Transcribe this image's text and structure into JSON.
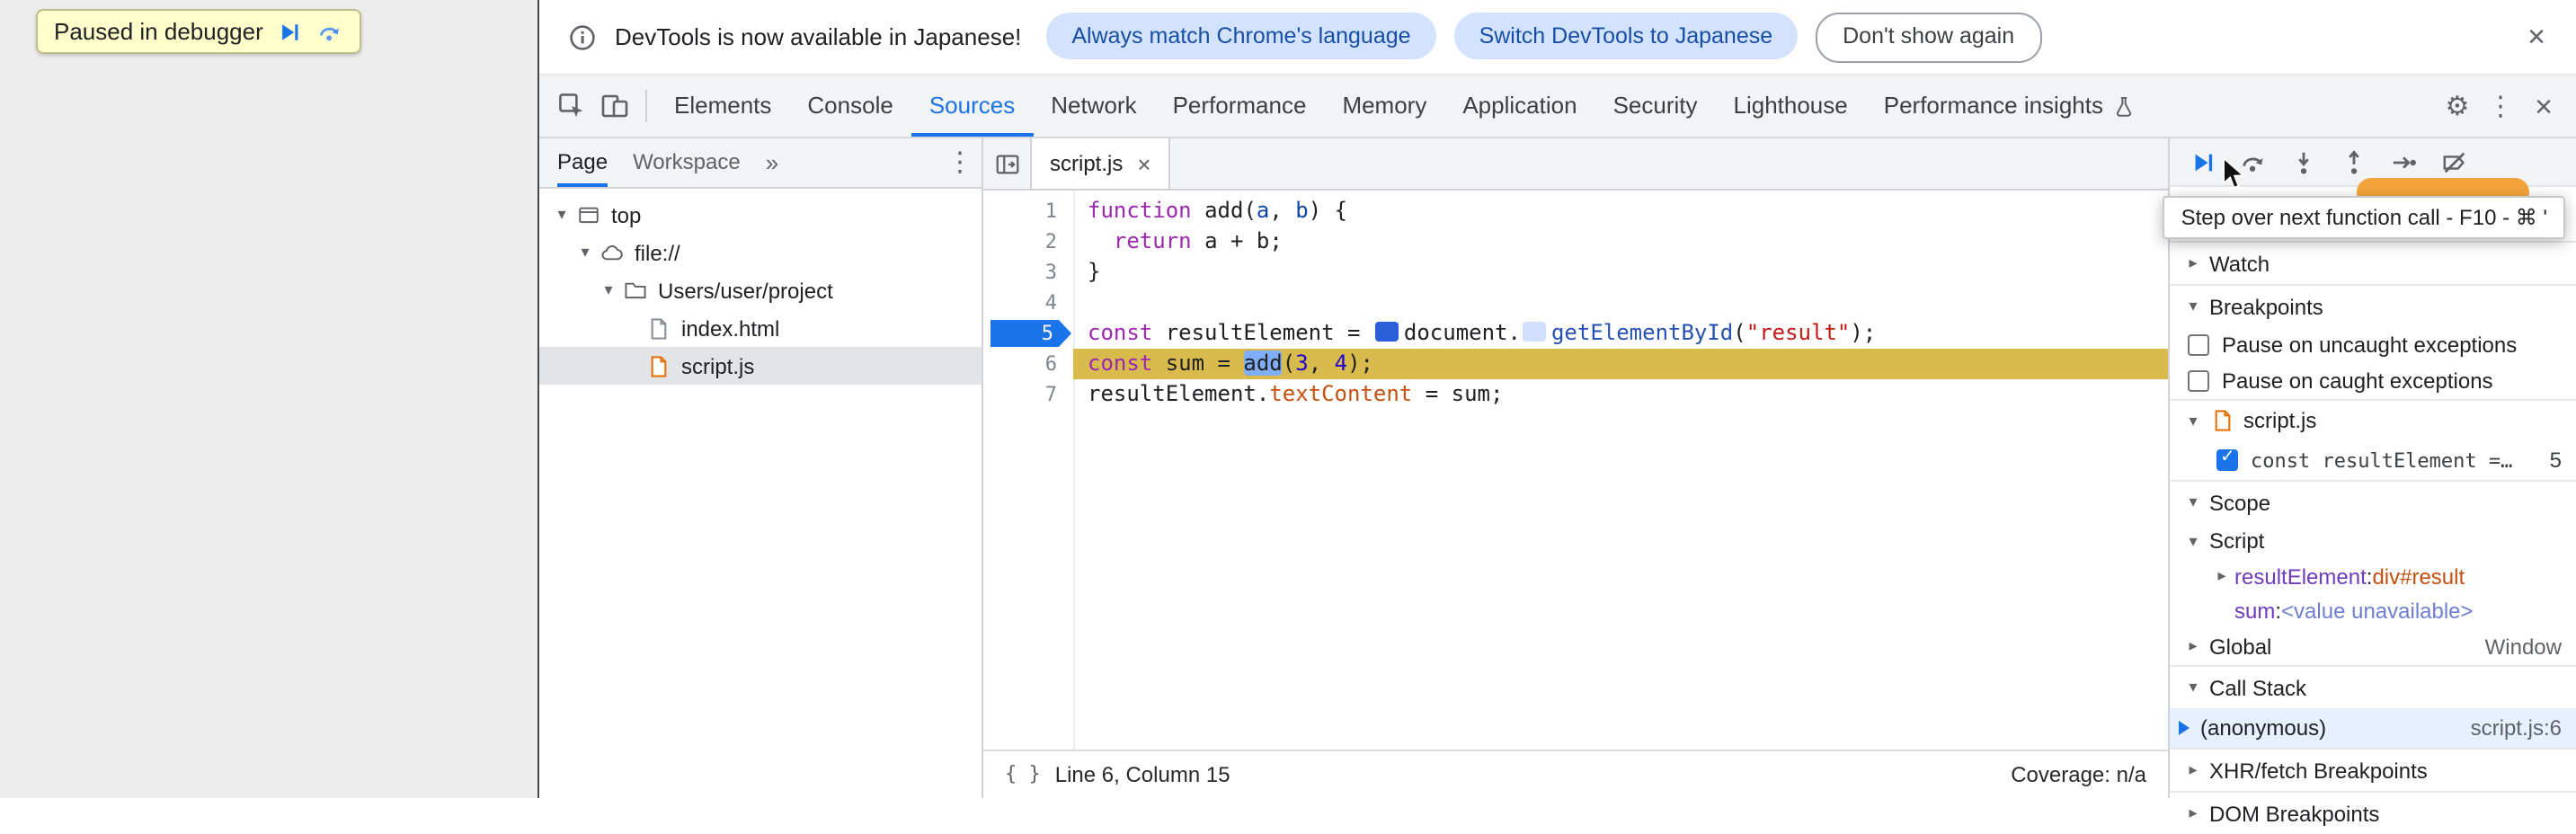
{
  "colors": {
    "accent": "#1a73e8",
    "execution_line_highlight": "#d8ba4d",
    "breakpoint_blue": "#1a73e8",
    "toast_background": "#ffffcc",
    "toolbar_background": "#f1f3f4",
    "selection_blue": "#7fadf7",
    "string_red": "#c41a16",
    "keyword_purple": "#9c27b0"
  },
  "icons": {
    "settings": "⚙",
    "vertical_dots": "⋮",
    "close": "×",
    "overflow_tabs": "»",
    "pretty_print": "{ }",
    "arrow_down": "▾",
    "arrow_right": "▸"
  },
  "page_overlay": {
    "paused_label": "Paused in debugger"
  },
  "infobar": {
    "message": "DevTools is now available in Japanese!",
    "buttons": [
      {
        "label": "Always match Chrome's language",
        "style": "tonal"
      },
      {
        "label": "Switch DevTools to Japanese",
        "style": "tonal"
      },
      {
        "label": "Don't show again",
        "style": "outline"
      }
    ]
  },
  "toolbar": {
    "tabs": [
      {
        "label": "Elements"
      },
      {
        "label": "Console"
      },
      {
        "label": "Sources",
        "selected": true
      },
      {
        "label": "Network"
      },
      {
        "label": "Performance"
      },
      {
        "label": "Memory"
      },
      {
        "label": "Application"
      },
      {
        "label": "Security"
      },
      {
        "label": "Lighthouse"
      },
      {
        "label": "Performance insights",
        "experiment": true
      }
    ]
  },
  "navigator": {
    "tabs": [
      "Page",
      "Workspace"
    ],
    "tree": [
      {
        "label": "top",
        "icon": "frame",
        "depth": 0,
        "arrow": "down"
      },
      {
        "label": "file://",
        "icon": "cloud",
        "depth": 1,
        "arrow": "down"
      },
      {
        "label": "Users/user/project",
        "icon": "folder",
        "depth": 2,
        "arrow": "down"
      },
      {
        "label": "index.html",
        "icon": "file-html",
        "depth": 3,
        "arrow": "none"
      },
      {
        "label": "script.js",
        "icon": "file-js",
        "depth": 3,
        "arrow": "none",
        "selected": true
      }
    ]
  },
  "editor": {
    "tab": "script.js",
    "status": {
      "position": "Line 6, Column 15",
      "coverage": "Coverage: n/a"
    },
    "lines": [
      {
        "n": 1,
        "tokens": [
          [
            "kw",
            "function"
          ],
          [
            "pl",
            " "
          ],
          [
            "fn",
            "add"
          ],
          [
            "pl",
            "("
          ],
          [
            "df",
            "a"
          ],
          [
            "pl",
            ", "
          ],
          [
            "df",
            "b"
          ],
          [
            "pl",
            ") {"
          ]
        ]
      },
      {
        "n": 2,
        "tokens": [
          [
            "pl",
            "  "
          ],
          [
            "kw",
            "return"
          ],
          [
            "pl",
            " a + b;"
          ]
        ]
      },
      {
        "n": 3,
        "tokens": [
          [
            "pl",
            "}"
          ]
        ]
      },
      {
        "n": 4,
        "tokens": []
      },
      {
        "n": 5,
        "bp": true,
        "tokens": [
          [
            "kw",
            "const"
          ],
          [
            "pl",
            " resultElement = "
          ],
          [
            "mks",
            ""
          ],
          [
            "pl",
            "document."
          ],
          [
            "mkp",
            ""
          ],
          [
            "mt",
            "getElementById"
          ],
          [
            "pl",
            "("
          ],
          [
            "st",
            "\"result\""
          ],
          [
            "pl",
            ");"
          ]
        ]
      },
      {
        "n": 6,
        "exec": true,
        "tokens": [
          [
            "kw",
            "const"
          ],
          [
            "pl",
            " sum = "
          ],
          [
            "sel",
            "add"
          ],
          [
            "pl",
            "("
          ],
          [
            "nu",
            "3"
          ],
          [
            "pl",
            ", "
          ],
          [
            "nu",
            "4"
          ],
          [
            "pl",
            ");"
          ]
        ]
      },
      {
        "n": 7,
        "tokens": [
          [
            "pl",
            "resultElement."
          ],
          [
            "pr",
            "textContent"
          ],
          [
            "pl",
            " = sum;"
          ]
        ]
      }
    ]
  },
  "debugger": {
    "tooltip": "Step over next function call - F10 - ⌘ '",
    "watch_label": "Watch",
    "breakpoints": {
      "title": "Breakpoints",
      "pause_uncaught": "Pause on uncaught exceptions",
      "pause_caught": "Pause on caught exceptions",
      "file": "script.js",
      "entry": {
        "code": "const resultElement = doc⋯",
        "line": "5",
        "checked": true
      }
    },
    "scope": {
      "title": "Scope",
      "category": "Script",
      "vars": [
        {
          "name": "resultElement",
          "value": "div#result",
          "style": "node",
          "expandable": true
        },
        {
          "name": "sum",
          "value": "<value unavailable>",
          "style": "unavailable",
          "expandable": false
        }
      ],
      "global_label": "Global",
      "global_value": "Window"
    },
    "call_stack": {
      "title": "Call Stack",
      "frames": [
        {
          "name": "(anonymous)",
          "location": "script.js:6",
          "active": true
        }
      ]
    },
    "xhr_label": "XHR/fetch Breakpoints",
    "dom_label": "DOM Breakpoints"
  }
}
